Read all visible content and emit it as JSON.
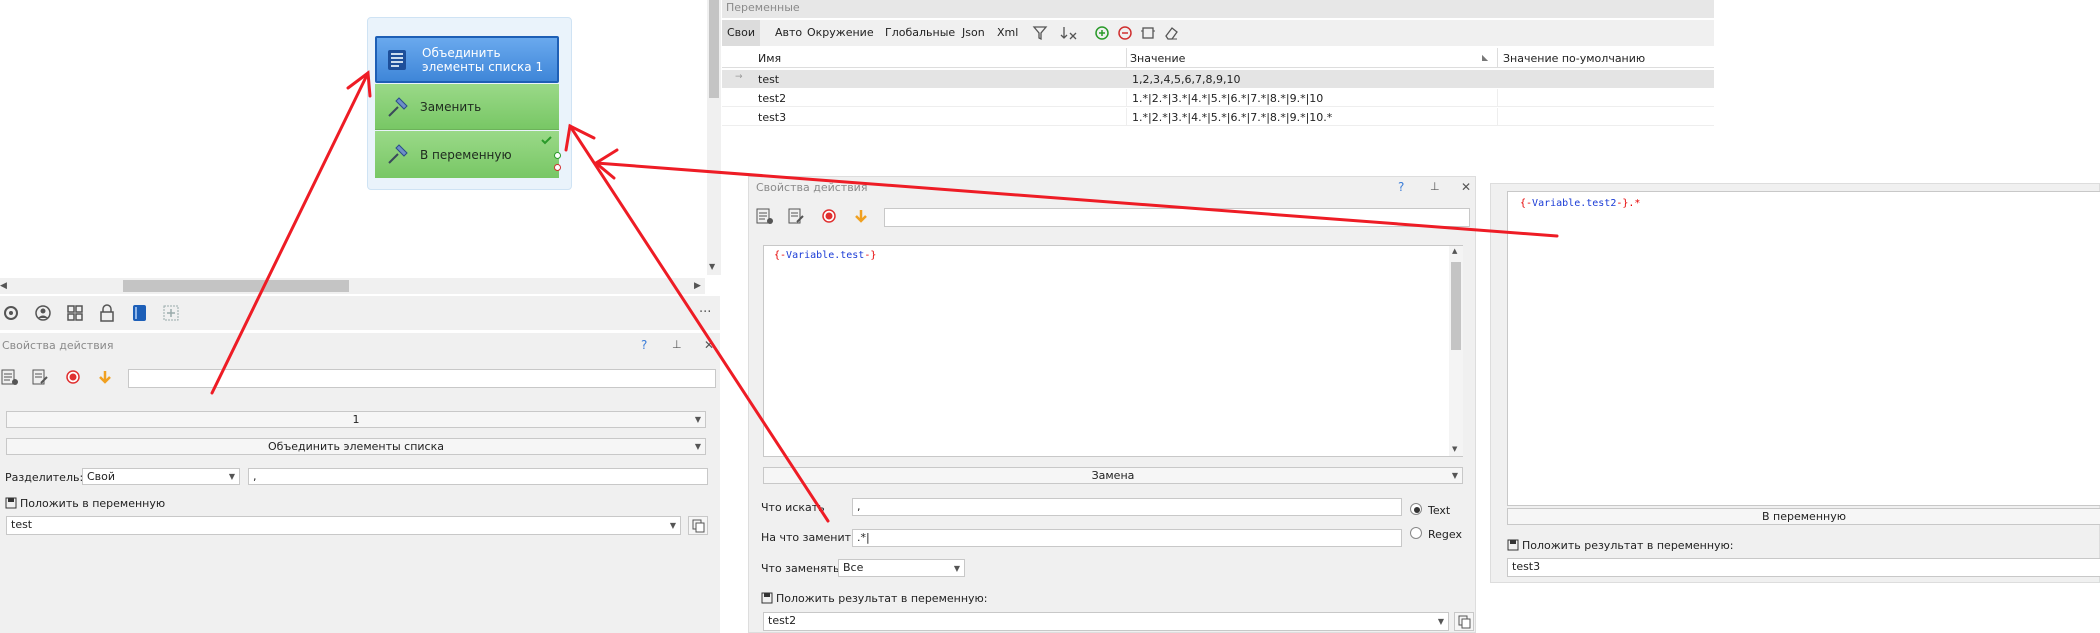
{
  "colors": {
    "accent_blue": "#4a8fe0",
    "node_green": "#8fd27a",
    "arrow_red": "#ee1c25",
    "tab_bg": "#e7e7e7"
  },
  "canvas": {
    "nodes": [
      {
        "label": "Объединить элементы списка 1",
        "icon": "list-book-icon"
      },
      {
        "label": "Заменить",
        "icon": "pin-icon"
      },
      {
        "label": "В переменную",
        "icon": "pin-icon"
      }
    ]
  },
  "toolbar_left": {
    "icons": [
      "gear-icon",
      "user-circle-icon",
      "grid-icon",
      "lock-icon",
      "book-icon",
      "add-frame-icon"
    ],
    "more": "···"
  },
  "left_props": {
    "title": "Свойства действия",
    "help": "?",
    "pin": "⊥",
    "close": "✕",
    "combo1": "1",
    "combo2": "Объединить элементы списка",
    "separator_label": "Разделитель:",
    "separator_mode": "Свой",
    "separator_value": ",",
    "save_label": "Положить в переменную",
    "save_value": "test"
  },
  "variables": {
    "header": "Переменные",
    "tabs": [
      "Свои",
      "Авто",
      "Окружение",
      "Глобальные",
      "Json",
      "Xml"
    ],
    "columns": [
      "Имя",
      "Значение",
      "Значение по-умолчанию"
    ],
    "rows": [
      {
        "marker": "→",
        "name": "test",
        "value": "1,2,3,4,5,6,7,8,9,10",
        "default": ""
      },
      {
        "marker": "",
        "name": "test2",
        "value": "1.*|2.*|3.*|4.*|5.*|6.*|7.*|8.*|9.*|10",
        "default": ""
      },
      {
        "marker": "",
        "name": "test3",
        "value": "1.*|2.*|3.*|4.*|5.*|6.*|7.*|8.*|9.*|10.*",
        "default": ""
      }
    ]
  },
  "mid_props": {
    "title": "Свойства действия",
    "help": "?",
    "pin": "⊥",
    "close": "✕",
    "code_open": "{-",
    "code_var": "Variable.test",
    "code_close": "-}",
    "combo": "Замена",
    "find_label": "Что искать",
    "find_value": ",",
    "replace_label": "На что заменить",
    "replace_value": ".*|",
    "what_label": "Что заменять",
    "what_value": "Все",
    "radio_text": "Text",
    "radio_regex": "Regex",
    "save_label": "Положить результат в переменную:",
    "save_value": "test2"
  },
  "right_props": {
    "code_open": "{-",
    "code_var": "Variable.test2",
    "code_close": "-}",
    "code_suffix": ".*",
    "combo": "В переменную",
    "save_label": "Положить результат в переменную:",
    "save_value": "test3"
  }
}
